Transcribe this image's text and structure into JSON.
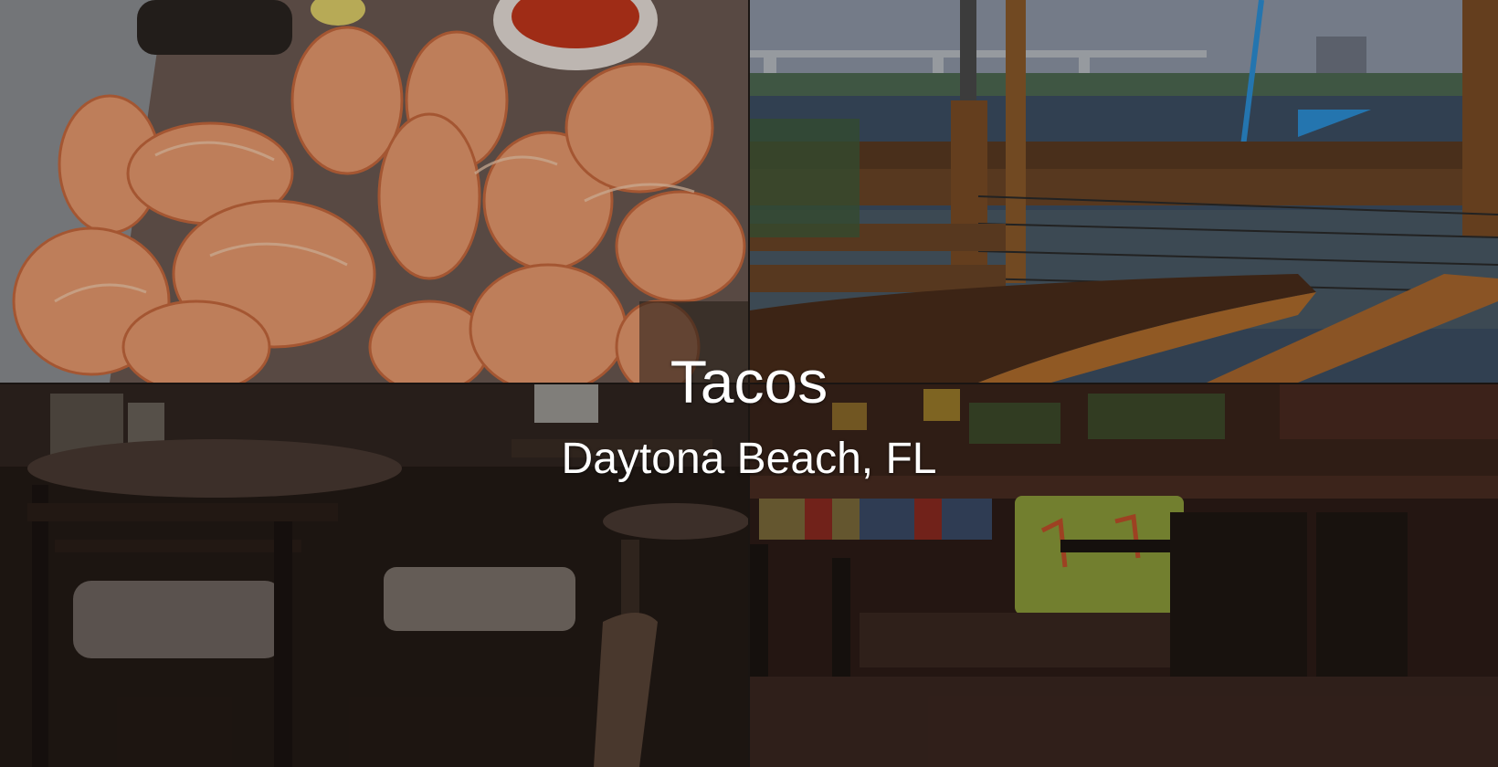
{
  "hero": {
    "title": "Tacos",
    "location": "Daytona Beach, FL"
  },
  "photos": [
    {
      "subject": "seasoned-shrimp-basket"
    },
    {
      "subject": "waterfront-deck-table"
    },
    {
      "subject": "dim-dining-room-chairs"
    },
    {
      "subject": "booth-seating-tropical-upholstery"
    }
  ],
  "colors": {
    "text": "#ffffff",
    "shrimp": "#e89a6e",
    "water": "#3c4f63",
    "wood": "#8a5a2a"
  }
}
